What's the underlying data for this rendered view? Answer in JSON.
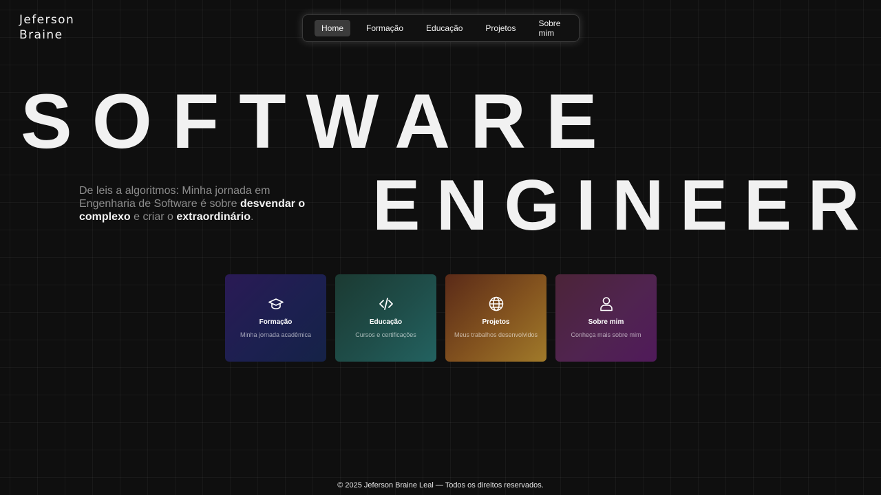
{
  "brand": {
    "line1": "Jeferson",
    "line2": "Braine"
  },
  "nav": {
    "items": [
      {
        "label": "Home",
        "active": true
      },
      {
        "label": "Formação",
        "active": false
      },
      {
        "label": "Educação",
        "active": false
      },
      {
        "label": "Projetos",
        "active": false
      },
      {
        "label": "Sobre mim",
        "active": false
      }
    ]
  },
  "hero": {
    "line1": "SOFTWARE",
    "line2": "ENGINEER"
  },
  "tagline": {
    "part1": "De leis a algoritmos: Minha jornada em Engenharia de Software é sobre ",
    "bold1": "desvendar o complexo",
    "part2": " e criar o ",
    "bold2": "extraordinário",
    "part3": "."
  },
  "cards": [
    {
      "icon": "graduation-cap-icon",
      "title": "Formação",
      "subtitle": "Minha jornada acadêmica"
    },
    {
      "icon": "code-icon",
      "title": "Educação",
      "subtitle": "Cursos e certificações"
    },
    {
      "icon": "globe-icon",
      "title": "Projetos",
      "subtitle": "Meus trabalhos desenvolvidos"
    },
    {
      "icon": "user-icon",
      "title": "Sobre mim",
      "subtitle": "Conheça mais sobre mim"
    }
  ],
  "footer": {
    "text": "© 2025 Jeferson Braine Leal — Todos os direitos reservados."
  },
  "colors": {
    "background": "#0f0f0f",
    "text": "#f1f1f1",
    "muted_text": "#8c8c8c",
    "card_formacao": "#1c2050",
    "card_educacao": "#1f4e4a",
    "card_projetos": "#84541f",
    "card_sobre": "#502450"
  }
}
